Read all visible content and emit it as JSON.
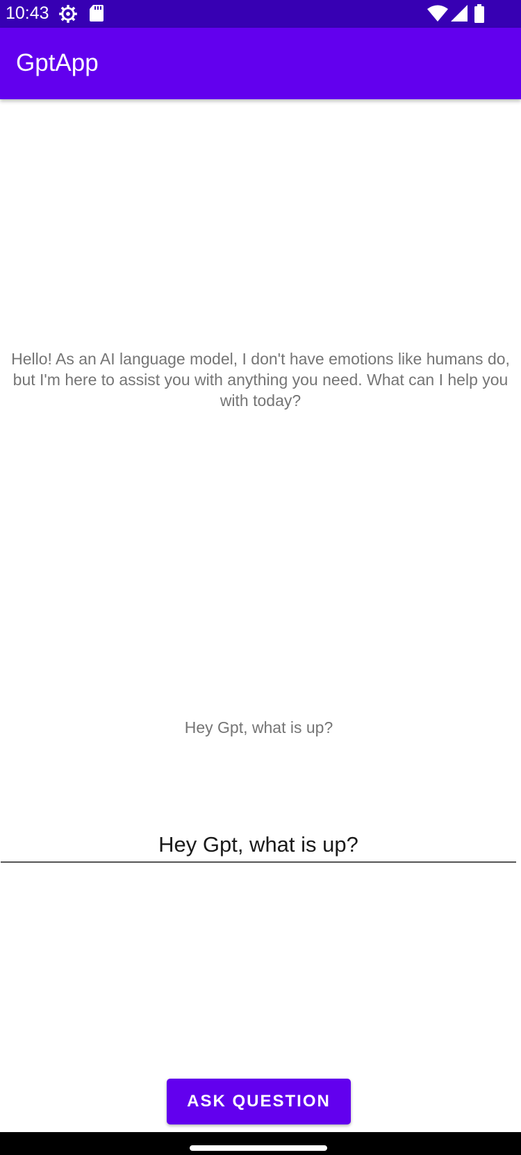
{
  "status_bar": {
    "time": "10:43",
    "icons": [
      "settings-gear-icon",
      "sd-card-icon",
      "wifi-icon",
      "cell-signal-icon",
      "battery-icon"
    ],
    "background": "#3700B3"
  },
  "app_bar": {
    "title": "GptApp",
    "background": "#6200EE"
  },
  "main": {
    "response_text": "Hello! As an AI language model, I don't have emotions like humans do, but I'm here to assist you with anything you need. What can I help you with today?",
    "asked_question": "Hey Gpt, what is up?"
  },
  "input": {
    "value": "Hey Gpt, what is up?"
  },
  "actions": {
    "ask_label": "ASK QUESTION",
    "accent": "#6200EE"
  }
}
